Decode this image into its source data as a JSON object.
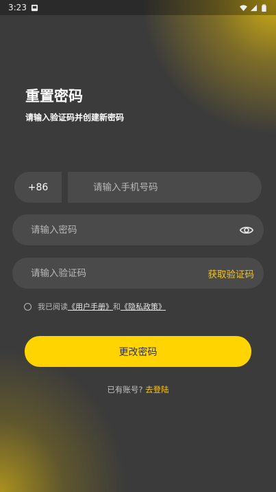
{
  "status_bar": {
    "time": "3:23",
    "icons": [
      "notification-icon",
      "wifi-icon",
      "signal-icon",
      "battery-icon"
    ]
  },
  "header": {
    "title": "重置密码",
    "subtitle": "请输入验证码并创建新密码"
  },
  "phone": {
    "country_code": "+86",
    "placeholder": "请输入手机号码",
    "value": ""
  },
  "password": {
    "placeholder": "请输入密码",
    "value": "",
    "toggle_icon": "eye-icon"
  },
  "code": {
    "placeholder": "请输入验证码",
    "value": "",
    "get_code_label": "获取验证码"
  },
  "agreement": {
    "prefix": "我已阅读",
    "link1": "《用户手册》",
    "middle": "和",
    "link2": "《隐私政策》",
    "checked": false
  },
  "submit": {
    "label": "更改密码"
  },
  "login": {
    "prefix": "已有账号?",
    "link": "去登陆"
  },
  "colors": {
    "accent": "#ffd400",
    "link_accent": "#f5c518",
    "background": "#3b3b3b",
    "field": "#4a4a4a"
  }
}
